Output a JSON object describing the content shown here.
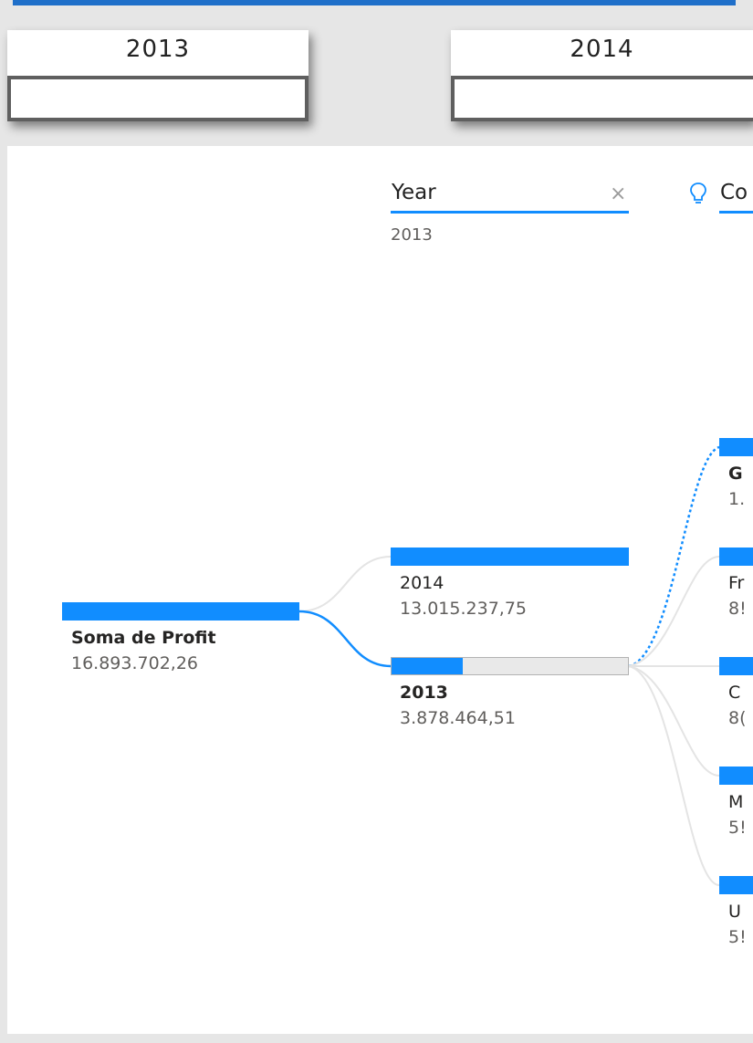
{
  "slicers": [
    {
      "title": "2013"
    },
    {
      "title": "2014"
    }
  ],
  "tree": {
    "root": {
      "label": "Soma de Profit",
      "value": "16.893.702,26"
    },
    "level1": {
      "header": "Year",
      "filter_value": "2013",
      "close_icon": "×",
      "nodes": [
        {
          "label": "2014",
          "value": "13.015.237,75",
          "fraction": 1.0,
          "selected": false
        },
        {
          "label": "2013",
          "value": "3.878.464,51",
          "fraction": 0.3,
          "selected": true
        }
      ]
    },
    "level2": {
      "header": "Co",
      "header_icon": "lightbulb-icon",
      "nodes": [
        {
          "label": "G",
          "value": "1.",
          "bold": true
        },
        {
          "label": "Fr",
          "value": "8!"
        },
        {
          "label": "C",
          "value": "8("
        },
        {
          "label": "M",
          "value": "5!"
        },
        {
          "label": "U",
          "value": "5!"
        }
      ]
    }
  },
  "colors": {
    "accent": "#118dff",
    "topbar": "#1f6fc9",
    "connector": "#e4e4e4"
  }
}
